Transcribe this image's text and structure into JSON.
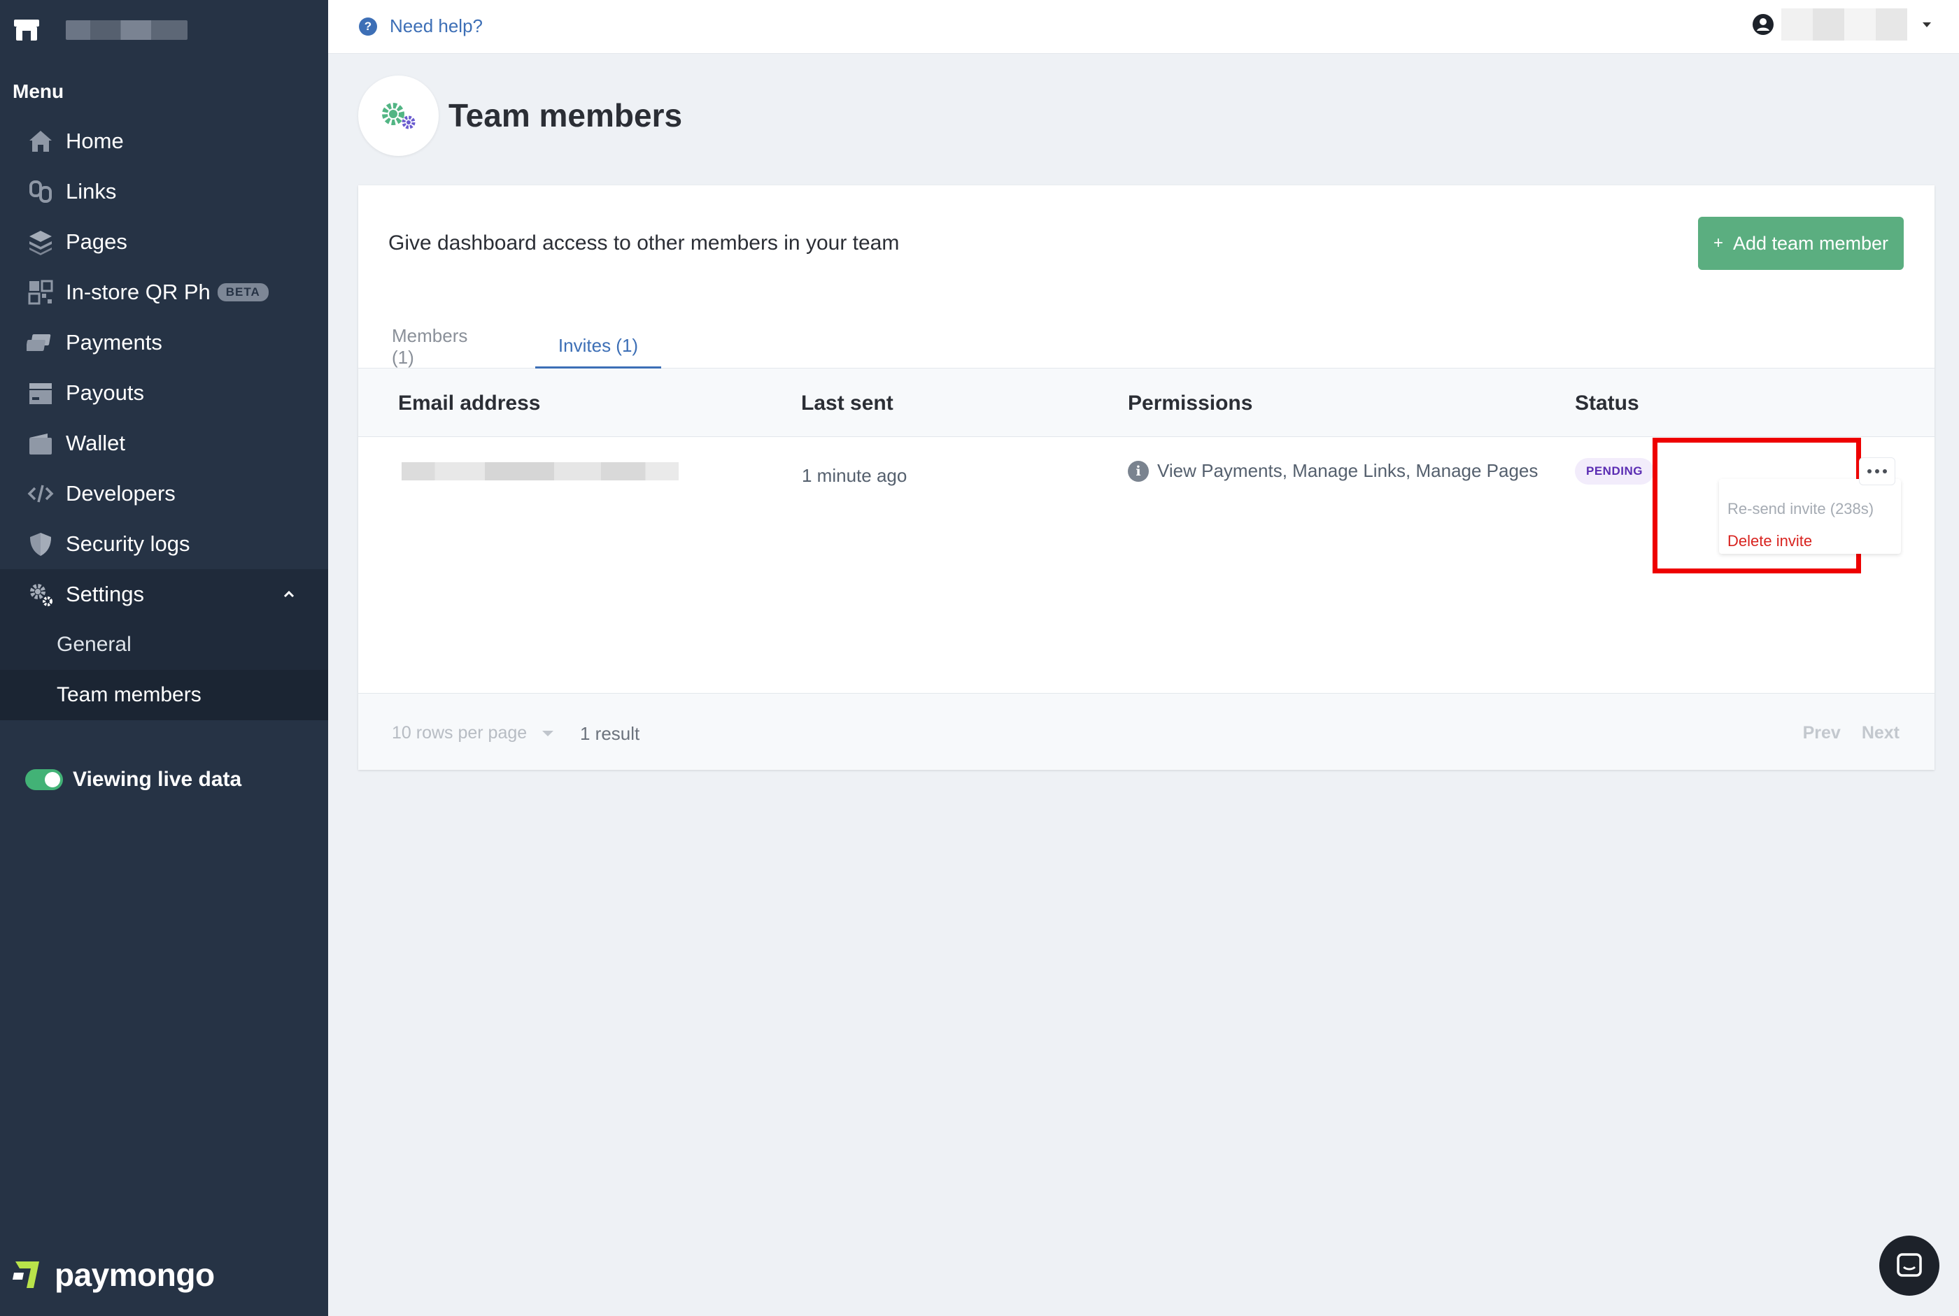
{
  "sidebar": {
    "menu_heading": "Menu",
    "items": [
      {
        "label": "Home",
        "icon": "home-icon"
      },
      {
        "label": "Links",
        "icon": "links-icon"
      },
      {
        "label": "Pages",
        "icon": "pages-icon"
      },
      {
        "label": "In-store QR Ph",
        "icon": "qr-icon",
        "badge": "BETA"
      },
      {
        "label": "Payments",
        "icon": "payments-icon"
      },
      {
        "label": "Payouts",
        "icon": "payouts-icon"
      },
      {
        "label": "Wallet",
        "icon": "wallet-icon"
      },
      {
        "label": "Developers",
        "icon": "code-icon"
      },
      {
        "label": "Security logs",
        "icon": "shield-icon"
      },
      {
        "label": "Settings",
        "icon": "gear-icon",
        "expanded": true
      }
    ],
    "settings_sub": [
      {
        "label": "General"
      },
      {
        "label": "Team members",
        "active": true
      }
    ],
    "live_toggle_label": "Viewing live data",
    "brand": "paymongo"
  },
  "topbar": {
    "help_label": "Need help?"
  },
  "page": {
    "title": "Team members",
    "description": "Give dashboard access to other members in your team",
    "add_button": "Add team member"
  },
  "tabs": [
    {
      "label": "Members (1)",
      "active": false
    },
    {
      "label": "Invites (1)",
      "active": true
    }
  ],
  "table": {
    "columns": [
      "Email address",
      "Last sent",
      "Permissions",
      "Status"
    ],
    "rows": [
      {
        "last_sent": "1 minute ago",
        "permissions": "View Payments, Manage Links, Manage Pages",
        "status": "PENDING"
      }
    ],
    "row_menu": {
      "resend": "Re-send invite (238s)",
      "delete": "Delete invite"
    },
    "footer": {
      "rows_per_page": "10 rows per page",
      "result_count": "1 result",
      "prev": "Prev",
      "next": "Next"
    }
  },
  "colors": {
    "sidebar_bg": "#263345",
    "accent_blue": "#3d6fb6",
    "primary_green": "#5bae80",
    "delete_red": "#d8231f",
    "highlight_red": "#ee0000"
  }
}
